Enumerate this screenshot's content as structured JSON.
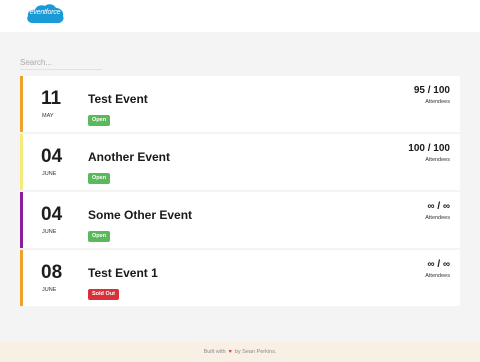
{
  "brand": {
    "logo_text": "eventforce"
  },
  "search": {
    "placeholder": "Search..."
  },
  "colors": {
    "open": "#5cb85c",
    "sold_out": "#d9313a",
    "accent_orange": "#f0a12c",
    "accent_yellow": "#f7ea7c",
    "accent_purple": "#8a1e9c",
    "logo_blue": "#1b9ad8",
    "footer_bg": "#f8f0e4"
  },
  "events": [
    {
      "day": "11",
      "month": "MAY",
      "title": "Test Event",
      "status": "Open",
      "count": "95 / 100",
      "attendees_label": "Attendees",
      "accent": "#f0a12c",
      "status_color": "#5cb85c"
    },
    {
      "day": "04",
      "month": "JUNE",
      "title": "Another Event",
      "status": "Open",
      "count": "100 / 100",
      "attendees_label": "Attendees",
      "accent": "#f7ea7c",
      "status_color": "#5cb85c"
    },
    {
      "day": "04",
      "month": "JUNE",
      "title": "Some Other Event",
      "status": "Open",
      "count": "∞ / ∞",
      "attendees_label": "Attendees",
      "accent": "#8a1e9c",
      "status_color": "#5cb85c"
    },
    {
      "day": "08",
      "month": "JUNE",
      "title": "Test Event 1",
      "status": "Sold Out",
      "count": "∞ / ∞",
      "attendees_label": "Attendees",
      "accent": "#f0a12c",
      "status_color": "#d9313a"
    }
  ],
  "footer": {
    "built_with": "Built with",
    "heart_icon": "heart-icon",
    "by": "by Sean Perkins."
  }
}
